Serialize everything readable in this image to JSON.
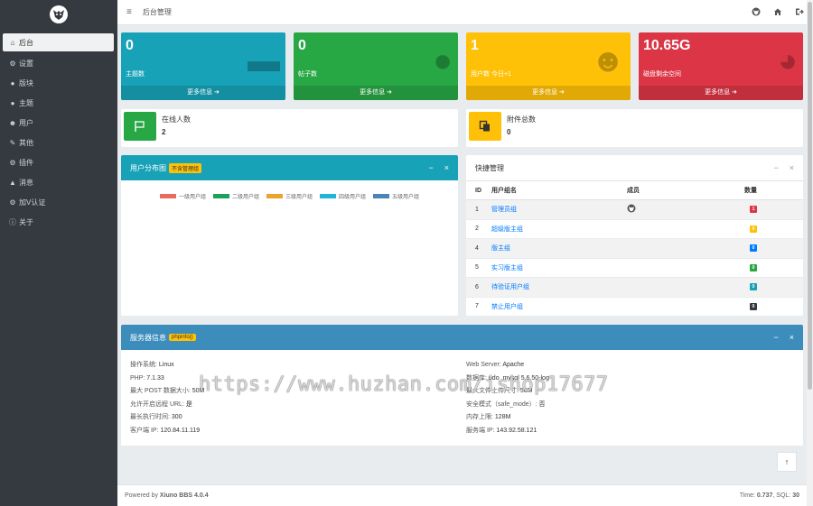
{
  "sidebar": {
    "items": [
      {
        "label": "后台",
        "icon": "home-icon",
        "glyph": "⌂"
      },
      {
        "label": "设置",
        "icon": "gear-icon",
        "glyph": "⚙"
      },
      {
        "label": "版块",
        "icon": "chat-icon",
        "glyph": "●"
      },
      {
        "label": "主题",
        "icon": "chat-icon",
        "glyph": "●"
      },
      {
        "label": "用户",
        "icon": "user-icon",
        "glyph": "☻"
      },
      {
        "label": "其他",
        "icon": "wrench-icon",
        "glyph": "✎"
      },
      {
        "label": "插件",
        "icon": "gears-icon",
        "glyph": "⚙"
      },
      {
        "label": "消息",
        "icon": "bell-icon",
        "glyph": "▲"
      },
      {
        "label": "加V认证",
        "icon": "gears-icon",
        "glyph": "⚙"
      },
      {
        "label": "关于",
        "icon": "info-icon",
        "glyph": "ⓘ"
      }
    ]
  },
  "topbar": {
    "menu_glyph": "≡",
    "breadcrumb": "后台管理"
  },
  "stats": [
    {
      "value": "0",
      "label": "主题数",
      "more": "更多信息 ➔",
      "color": "#17a2b8",
      "icon": "comment-icon",
      "glyph": "▬"
    },
    {
      "value": "0",
      "label": "帖子数",
      "more": "更多信息 ➔",
      "color": "#28a745",
      "icon": "comments-icon",
      "glyph": "●"
    },
    {
      "value": "1",
      "label": "用户数 今日+1",
      "more": "更多信息 ➔",
      "color": "#ffc107",
      "icon": "users-icon",
      "glyph": "☻"
    },
    {
      "value": "10.65G",
      "label": "磁盘剩余空间",
      "more": "更多信息 ➔",
      "color": "#dc3545",
      "icon": "pie-chart-icon",
      "glyph": "◕"
    }
  ],
  "online": {
    "title": "在线人数",
    "value": "2",
    "color": "#28a745",
    "glyph": "⚑"
  },
  "attachments": {
    "title": "附件总数",
    "value": "0",
    "color": "#ffc107",
    "glyph": "❐"
  },
  "user_dist": {
    "title": "用户分布图",
    "tag": "不含管理组",
    "color": "#17a2b8",
    "legend": [
      {
        "label": "一级用户组",
        "color": "#e86b5c"
      },
      {
        "label": "二级用户组",
        "color": "#1aa15a"
      },
      {
        "label": "三级用户组",
        "color": "#eaa32b"
      },
      {
        "label": "四级用户组",
        "color": "#1fb5d6"
      },
      {
        "label": "五级用户组",
        "color": "#4a84b8"
      }
    ]
  },
  "quick": {
    "title": "快捷管理",
    "headers": [
      "ID",
      "用户组名",
      "成员",
      "数量"
    ],
    "rows": [
      {
        "id": "1",
        "name": "管理员组",
        "badge": "1",
        "badge_color": "#dc3545",
        "avatar": true
      },
      {
        "id": "2",
        "name": "超级版主组",
        "badge": "0",
        "badge_color": "#ffc107",
        "avatar": false
      },
      {
        "id": "4",
        "name": "版主组",
        "badge": "0",
        "badge_color": "#007bff",
        "avatar": false
      },
      {
        "id": "5",
        "name": "实习版主组",
        "badge": "0",
        "badge_color": "#28a745",
        "avatar": false
      },
      {
        "id": "6",
        "name": "待验证用户组",
        "badge": "0",
        "badge_color": "#17a2b8",
        "avatar": false
      },
      {
        "id": "7",
        "name": "禁止用户组",
        "badge": "0",
        "badge_color": "#343a40",
        "avatar": false
      }
    ]
  },
  "server": {
    "title": "服务器信息",
    "tag": "phpinfo()",
    "color": "#3c8dbc",
    "left": [
      {
        "k": "操作系统:",
        "v": "Linux"
      },
      {
        "k": "PHP:",
        "v": "7.1.33"
      },
      {
        "k": "最大 POST 数据大小:",
        "v": "50M"
      },
      {
        "k": "允许开启远程 URL:",
        "v": "是"
      },
      {
        "k": "最长执行时间:",
        "v": "300"
      },
      {
        "k": "客户端 IP:",
        "v": "120.84.11.119"
      }
    ],
    "right": [
      {
        "k": "Web Server:",
        "v": "Apache"
      },
      {
        "k": "数据库:",
        "v": "pdo_mysql 5.6.50-log"
      },
      {
        "k": "最大文件上传尺寸:",
        "v": "50M"
      },
      {
        "k": "安全模式（safe_mode）:",
        "v": "否"
      },
      {
        "k": "内存上限:",
        "v": "128M"
      },
      {
        "k": "服务端 IP:",
        "v": "143.92.58.121"
      }
    ]
  },
  "footer": {
    "powered_prefix": "Powered by ",
    "powered_name": "Xiuno BBS 4.0.4",
    "time_label": "Time: ",
    "time_value": "0.737",
    "sql_label": ", SQL: ",
    "sql_value": "30"
  },
  "watermark": "https://www.huzhan.com/ishop17677",
  "controls": {
    "minimize": "−",
    "close": "×",
    "up": "↑"
  }
}
